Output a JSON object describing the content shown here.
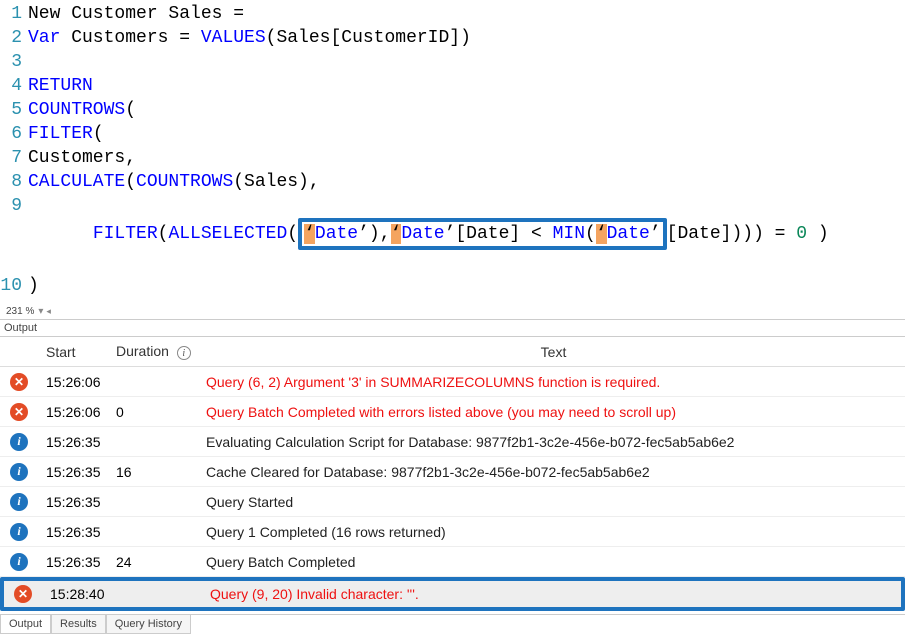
{
  "editor": {
    "lines": [
      {
        "num": "1",
        "tokens": [
          {
            "t": "New Customer Sales =",
            "c": ""
          }
        ]
      },
      {
        "num": "2",
        "tokens": [
          {
            "t": "Var",
            "c": "kw"
          },
          {
            "t": " Customers = ",
            "c": ""
          },
          {
            "t": "VALUES",
            "c": "fn"
          },
          {
            "t": "(Sales[CustomerID])",
            "c": ""
          }
        ]
      },
      {
        "num": "3",
        "tokens": []
      },
      {
        "num": "4",
        "tokens": [
          {
            "t": "RETURN",
            "c": "kw"
          }
        ]
      },
      {
        "num": "5",
        "tokens": [
          {
            "t": "COUNTROWS",
            "c": "fn"
          },
          {
            "t": "(",
            "c": ""
          }
        ]
      },
      {
        "num": "6",
        "tokens": [
          {
            "t": "FILTER",
            "c": "fn"
          },
          {
            "t": "(",
            "c": ""
          }
        ]
      },
      {
        "num": "7",
        "tokens": [
          {
            "t": "Customers,",
            "c": ""
          }
        ]
      },
      {
        "num": "8",
        "tokens": [
          {
            "t": "CALCULATE",
            "c": "fn"
          },
          {
            "t": "(",
            "c": ""
          },
          {
            "t": "COUNTROWS",
            "c": "fn"
          },
          {
            "t": "(Sales),",
            "c": ""
          }
        ]
      }
    ],
    "line9": {
      "num": "9",
      "pre": "FILTER",
      "open": "(",
      "fn_all": "ALLSELECTED",
      "open2": "(",
      "q1a": "‘",
      "date1": "Date",
      "q1b": "’",
      "close1": "),",
      "q2a": "‘",
      "date2": "Date",
      "q2b": "’",
      "col": "[Date] < ",
      "fn_min": "MIN",
      "open3": "(",
      "q3a": "‘",
      "date3": "Date",
      "q3b": "’",
      "rest": "[Date]))) = ",
      "zero": "0",
      "end": " )"
    },
    "line10": {
      "num": "10",
      "text": ")"
    }
  },
  "zoom": "231 %",
  "panels": {
    "output_label": "Output",
    "headers": {
      "start": "Start",
      "duration": "Duration",
      "text": "Text"
    },
    "rows": [
      {
        "icon": "error",
        "start": "15:26:06",
        "dur": "",
        "text": "Query (6, 2) Argument '3' in SUMMARIZECOLUMNS function is required.",
        "kind": "error"
      },
      {
        "icon": "error",
        "start": "15:26:06",
        "dur": "0",
        "text": "Query Batch Completed with errors listed above (you may need to scroll up)",
        "kind": "error"
      },
      {
        "icon": "info",
        "start": "15:26:35",
        "dur": "",
        "text": "Evaluating Calculation Script for Database: 9877f2b1-3c2e-456e-b072-fec5ab5ab6e2",
        "kind": "info"
      },
      {
        "icon": "info",
        "start": "15:26:35",
        "dur": "16",
        "text": "Cache Cleared for Database: 9877f2b1-3c2e-456e-b072-fec5ab5ab6e2",
        "kind": "info"
      },
      {
        "icon": "info",
        "start": "15:26:35",
        "dur": "",
        "text": "Query Started",
        "kind": "info"
      },
      {
        "icon": "info",
        "start": "15:26:35",
        "dur": "",
        "text": "Query 1 Completed (16 rows returned)",
        "kind": "info"
      },
      {
        "icon": "info",
        "start": "15:26:35",
        "dur": "24",
        "text": "Query Batch Completed",
        "kind": "info"
      },
      {
        "icon": "error",
        "start": "15:28:40",
        "dur": "",
        "text": "Query (9, 20) Invalid character: '''.",
        "kind": "error",
        "highlight": true
      }
    ]
  },
  "tabs": {
    "output": "Output",
    "results": "Results",
    "history": "Query History"
  }
}
